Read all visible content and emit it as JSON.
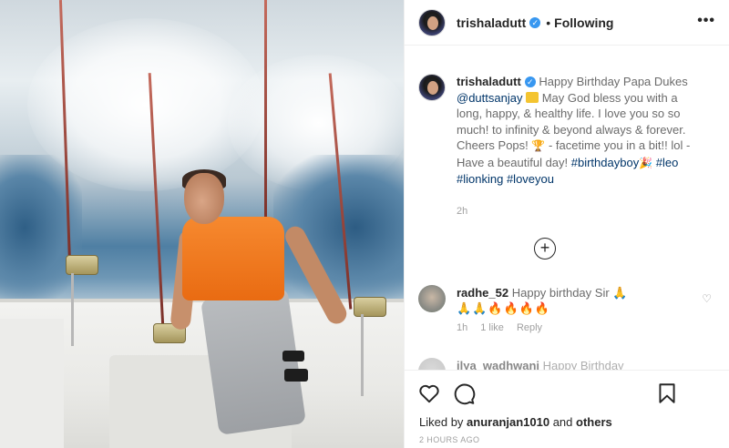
{
  "post": {
    "header": {
      "username": "trishaladutt",
      "separator": "•",
      "follow_status": "Following",
      "more_label": "•••"
    },
    "caption": {
      "username": "trishaladutt",
      "part1": "Happy Birthday Papa Dukes ",
      "mention": "@duttsanjay",
      "part2": " May God bless you with a long, happy, & healthy life. I love you so so much! to infinity & beyond always & forever. Cheers Pops! ",
      "part3": " - facetime you in a bit!! lol - Have a beautiful day! ",
      "hashtag1": "#birthdayboy",
      "hashtag2": "#leo",
      "hashtag3": "#lionking",
      "hashtag4": "#loveyou",
      "time": "2h"
    },
    "load_more_label": "+",
    "comments": [
      {
        "username": "radhe_52",
        "text": "Happy birthday Sir 🙏",
        "emojis": "🙏🙏🔥🔥🔥🔥",
        "time": "1h",
        "likes": "1 like",
        "reply": "Reply"
      },
      {
        "username": "ilya_wadhwani",
        "text": "Happy Birthday"
      }
    ],
    "likes": {
      "prefix": "Liked by ",
      "user": "anuranjan1010",
      "suffix": " and ",
      "others": "others"
    },
    "timestamp": "2 HOURS AGO"
  },
  "icons": {
    "heart": "heart-icon",
    "comment": "comment-icon",
    "bookmark": "bookmark-icon",
    "more": "more-icon",
    "verified": "verified-icon"
  },
  "colors": {
    "verified": "#3897f0",
    "link": "#003569",
    "text": "#262626",
    "muted": "#a0a0a0",
    "shirt": "#f6892f"
  }
}
